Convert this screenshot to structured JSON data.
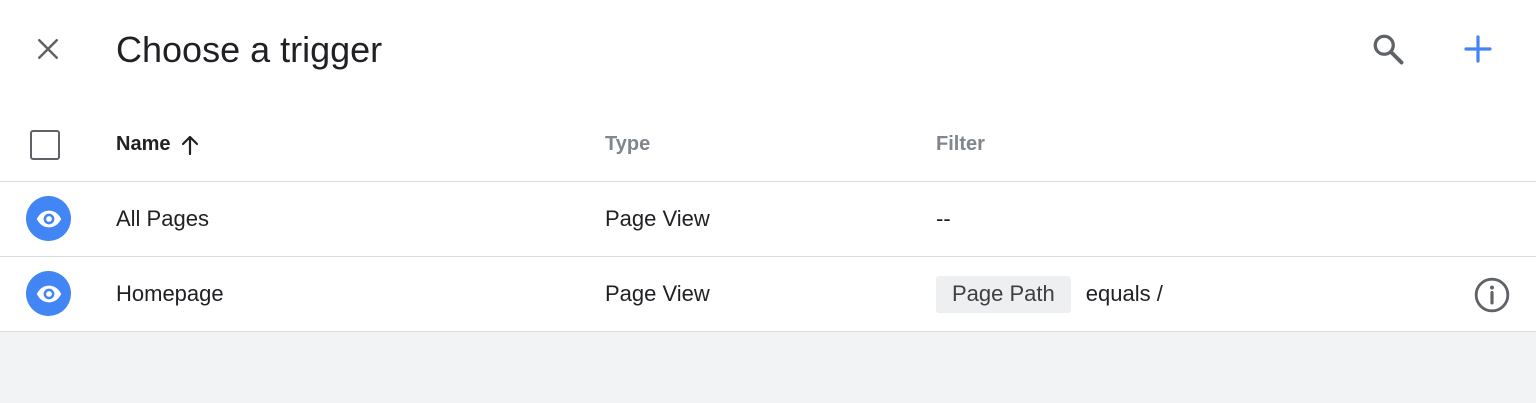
{
  "header": {
    "close_icon": "close-icon",
    "title": "Choose a trigger",
    "search_icon": "search-icon",
    "add_icon": "add-icon",
    "accent_color": "#4285f4"
  },
  "table": {
    "columns": {
      "name": "Name",
      "type": "Type",
      "filter": "Filter"
    },
    "sort": {
      "column": "Name",
      "direction": "ascending",
      "icon": "arrow-up-icon"
    },
    "rows": [
      {
        "icon": "eye-icon",
        "name": "All Pages",
        "type": "Page View",
        "filter": "--"
      },
      {
        "icon": "eye-icon",
        "name": "Homepage",
        "type": "Page View",
        "filter_chip": "Page Path",
        "filter_rest": "equals /",
        "trailing_icon": "info-icon"
      }
    ]
  }
}
